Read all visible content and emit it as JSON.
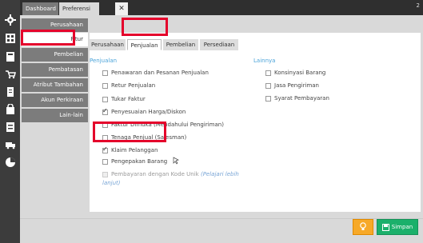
{
  "window": {
    "tabs": [
      {
        "label": "Dashboard"
      },
      {
        "label": "Preferensi"
      }
    ],
    "close_label": "✕",
    "right_indicator": "2"
  },
  "sidebar": {
    "items": [
      {
        "label": "Perusahaan"
      },
      {
        "label": "Fitur"
      },
      {
        "label": "Pembelian"
      },
      {
        "label": "Pembatasan"
      },
      {
        "label": "Atribut Tambahan"
      },
      {
        "label": "Akun Perkiraan"
      },
      {
        "label": "Lain-lain"
      }
    ]
  },
  "panel": {
    "subtabs": [
      {
        "label": "Perusahaan"
      },
      {
        "label": "Penjualan"
      },
      {
        "label": "Pembelian"
      },
      {
        "label": "Persediaan"
      }
    ],
    "penjualan_title": "Penjualan",
    "lainnya_title": "Lainnya",
    "penjualan_options": [
      {
        "label": "Penawaran dan Pesanan Penjualan",
        "checked": false
      },
      {
        "label": "Retur Penjualan",
        "checked": false
      },
      {
        "label": "Tukar Faktur",
        "checked": false
      },
      {
        "label": "Penyesuaian Harga/Diskon",
        "checked": true
      },
      {
        "label": "Faktur Dimuka (Mendahului Pengiriman)",
        "checked": false
      },
      {
        "label": "Tenaga Penjual (Salesman)",
        "checked": false
      },
      {
        "label": "Klaim Pelanggan",
        "checked": true
      },
      {
        "label": "Pengepakan Barang",
        "checked": false
      },
      {
        "label": "Pembayaran dengan Kode Unik",
        "checked": false,
        "disabled": true,
        "note_line1": "(Pelajari lebih",
        "note_line2": "lanjut)"
      }
    ],
    "lainnya_options": [
      {
        "label": "Konsinyasi Barang",
        "checked": false
      },
      {
        "label": "Jasa Pengiriman",
        "checked": false
      },
      {
        "label": "Syarat Pembayaran",
        "checked": false
      }
    ]
  },
  "footer": {
    "save_label": "Simpan"
  }
}
